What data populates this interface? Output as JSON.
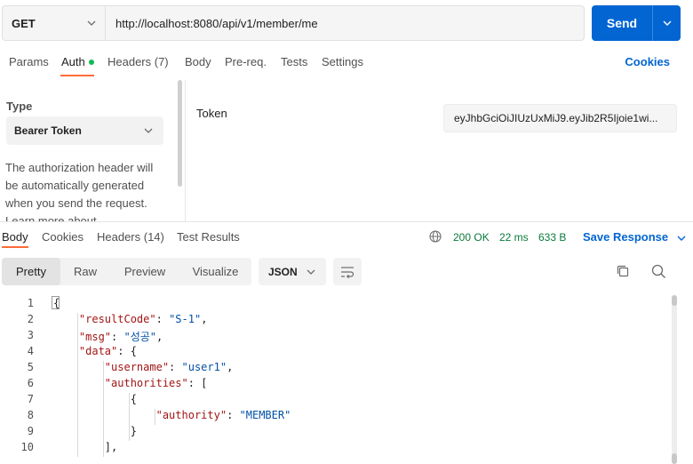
{
  "request": {
    "method": "GET",
    "url": "http://localhost:8080/api/v1/member/me",
    "send_label": "Send"
  },
  "request_tabs": [
    {
      "label": "Params"
    },
    {
      "label": "Auth"
    },
    {
      "label": "Headers (7)"
    },
    {
      "label": "Body"
    },
    {
      "label": "Pre-req."
    },
    {
      "label": "Tests"
    },
    {
      "label": "Settings"
    }
  ],
  "cookies_label": "Cookies",
  "auth": {
    "type_label": "Type",
    "type_value": "Bearer Token",
    "description": "The authorization header will be automatically generated when you send the request. Learn more about",
    "token_label": "Token",
    "token_value": "eyJhbGciOiJIUzUxMiJ9.eyJib2R5Ijoie1wi..."
  },
  "response_tabs": [
    {
      "label": "Body"
    },
    {
      "label": "Cookies"
    },
    {
      "label": "Headers (14)"
    },
    {
      "label": "Test Results"
    }
  ],
  "response_meta": {
    "status": "200 OK",
    "time": "22 ms",
    "size": "633 B",
    "save_label": "Save Response"
  },
  "view_modes": [
    {
      "label": "Pretty"
    },
    {
      "label": "Raw"
    },
    {
      "label": "Preview"
    },
    {
      "label": "Visualize"
    }
  ],
  "format": "JSON",
  "code_lines": [
    {
      "n": "1",
      "parts": [
        {
          "t": "{",
          "c": "p"
        }
      ]
    },
    {
      "n": "2",
      "parts": [
        {
          "t": "    ",
          "c": "p"
        },
        {
          "t": "\"resultCode\"",
          "c": "key"
        },
        {
          "t": ": ",
          "c": "p"
        },
        {
          "t": "\"S-1\"",
          "c": "str"
        },
        {
          "t": ",",
          "c": "p"
        }
      ]
    },
    {
      "n": "3",
      "parts": [
        {
          "t": "    ",
          "c": "p"
        },
        {
          "t": "\"msg\"",
          "c": "key"
        },
        {
          "t": ": ",
          "c": "p"
        },
        {
          "t": "\"성공\"",
          "c": "str"
        },
        {
          "t": ",",
          "c": "p"
        }
      ]
    },
    {
      "n": "4",
      "parts": [
        {
          "t": "    ",
          "c": "p"
        },
        {
          "t": "\"data\"",
          "c": "key"
        },
        {
          "t": ": {",
          "c": "p"
        }
      ]
    },
    {
      "n": "5",
      "parts": [
        {
          "t": "        ",
          "c": "p"
        },
        {
          "t": "\"username\"",
          "c": "key"
        },
        {
          "t": ": ",
          "c": "p"
        },
        {
          "t": "\"user1\"",
          "c": "str"
        },
        {
          "t": ",",
          "c": "p"
        }
      ]
    },
    {
      "n": "6",
      "parts": [
        {
          "t": "        ",
          "c": "p"
        },
        {
          "t": "\"authorities\"",
          "c": "key"
        },
        {
          "t": ": [",
          "c": "p"
        }
      ]
    },
    {
      "n": "7",
      "parts": [
        {
          "t": "            {",
          "c": "p"
        }
      ]
    },
    {
      "n": "8",
      "parts": [
        {
          "t": "                ",
          "c": "p"
        },
        {
          "t": "\"authority\"",
          "c": "key"
        },
        {
          "t": ": ",
          "c": "p"
        },
        {
          "t": "\"MEMBER\"",
          "c": "str"
        }
      ]
    },
    {
      "n": "9",
      "parts": [
        {
          "t": "            }",
          "c": "p"
        }
      ]
    },
    {
      "n": "10",
      "parts": [
        {
          "t": "        ],",
          "c": "p"
        }
      ]
    }
  ]
}
